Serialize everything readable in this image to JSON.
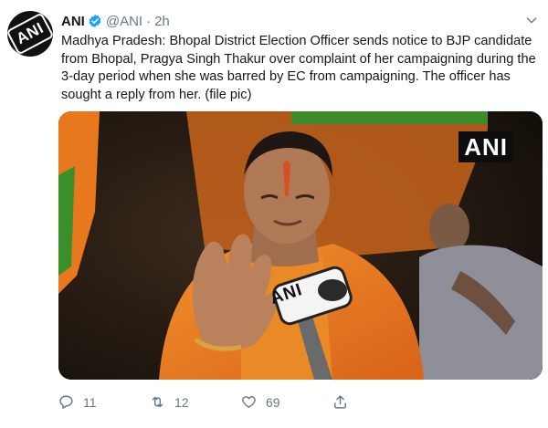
{
  "tweet": {
    "author_name": "ANI",
    "author_handle": "@ANI",
    "separator": "·",
    "time": "2h",
    "avatar_text": "ANI",
    "text": "Madhya Pradesh: Bhopal District Election Officer sends notice to BJP candidate from Bhopal, Pragya Singh Thakur over complaint of her campaigning during the 3-day period when she was barred by EC from campaigning. The officer has sought a reply from her. (file pic)",
    "media": {
      "watermark": "ANI",
      "mic_label": "ANI"
    },
    "actions": {
      "replies": "11",
      "retweets": "12",
      "likes": "69"
    }
  },
  "colors": {
    "text": "#14171a",
    "secondary": "#657786",
    "verified": "#1da1f2",
    "saffron": "#e8781e"
  },
  "icons": [
    "verified-badge-icon",
    "chevron-down-icon",
    "reply-icon",
    "retweet-icon",
    "like-icon",
    "share-icon"
  ]
}
